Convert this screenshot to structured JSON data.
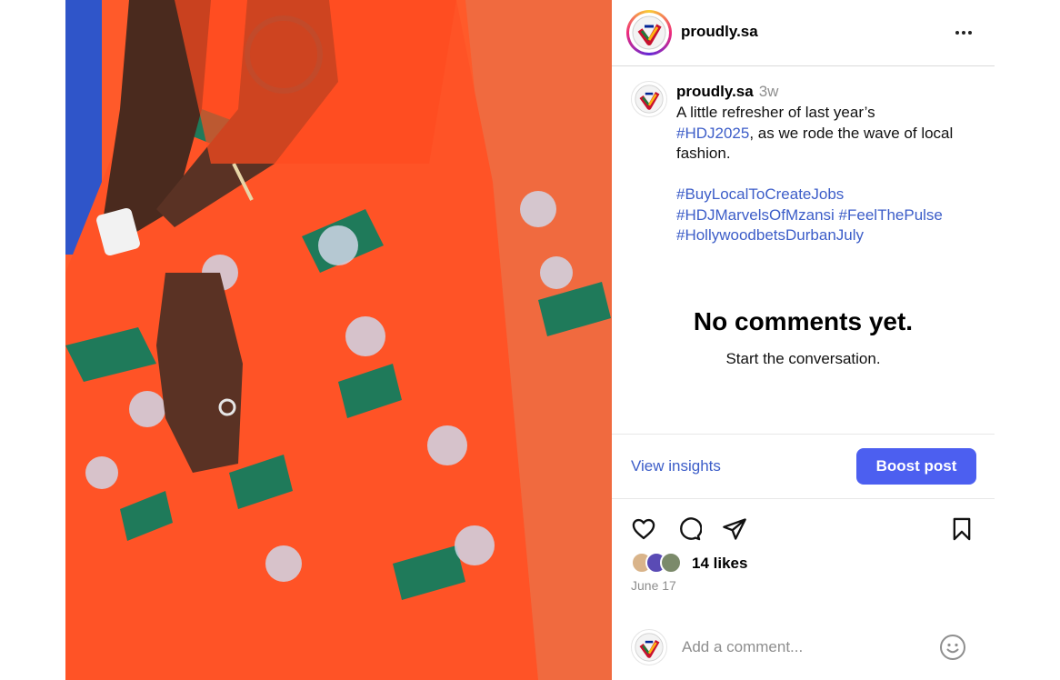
{
  "post": {
    "username": "proudly.sa",
    "more_icon": "more-horizontal-icon"
  },
  "caption": {
    "username": "proudly.sa",
    "time": "3w",
    "line1": "A little refresher of last year’s",
    "tag1": "#HDJ2025",
    "line2_rest": ", as we rode the wave of local",
    "line3": "fashion.",
    "hashtags": [
      "#BuyLocalToCreateJobs",
      "#HDJMarvelsOfMzansi",
      "#FeelThePulse",
      "#HollywoodbetsDurbanJuly"
    ]
  },
  "comments": {
    "empty_title": "No comments yet.",
    "empty_subtitle": "Start the conversation."
  },
  "actions": {
    "view_insights": "View insights",
    "boost_post": "Boost post",
    "icons": [
      "heart-icon",
      "comment-icon",
      "share-icon",
      "bookmark-icon"
    ]
  },
  "likes": {
    "count_text": "14 likes",
    "date": "June 17"
  },
  "composer": {
    "placeholder": "Add a comment...",
    "emoji_icon": "smiley-icon"
  },
  "colors": {
    "link": "#3c5dc8",
    "boost_button": "#4c5ff0",
    "photo_primary": "#ff5a2a",
    "photo_accent": "#1f7a5a",
    "photo_background": "#2f55c9"
  }
}
